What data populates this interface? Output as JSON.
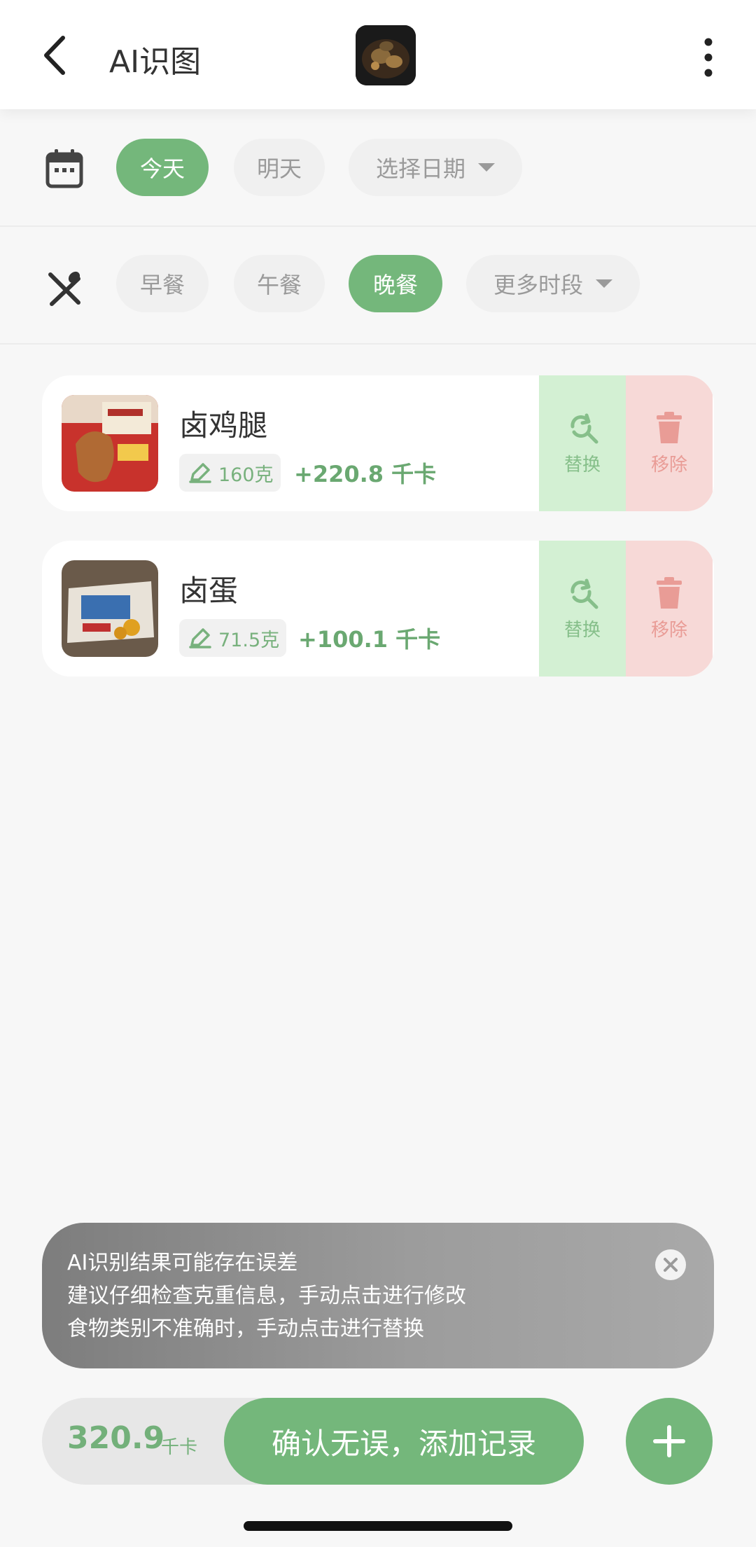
{
  "header": {
    "title": "AI识图",
    "back_icon": "chevron-left-icon",
    "more_icon": "more-vertical-icon"
  },
  "date_row": {
    "icon": "calendar-icon",
    "chips": [
      "今天",
      "明天",
      "选择日期"
    ],
    "active": "今天"
  },
  "meal_row": {
    "icon": "utensils-icon",
    "chips": [
      "早餐",
      "午餐",
      "晚餐",
      "更多时段"
    ],
    "active": "晚餐"
  },
  "foods": [
    {
      "name": "卤鸡腿",
      "weight": "160克",
      "kcal": "+220.8 千卡",
      "replace_label": "替换",
      "remove_label": "移除"
    },
    {
      "name": "卤蛋",
      "weight": "71.5克",
      "kcal": "+100.1 千卡",
      "replace_label": "替换",
      "remove_label": "移除"
    }
  ],
  "tip": {
    "lines": [
      "AI识别结果可能存在误差",
      "建议仔细检查克重信息，手动点击进行修改",
      "食物类别不准确时，手动点击进行替换"
    ]
  },
  "bottom": {
    "total": "320.9",
    "unit": "千卡",
    "confirm_label": "确认无误，添加记录"
  },
  "colors": {
    "accent": "#74b77b",
    "replace_bg": "#d3f0d3",
    "remove_bg": "#f7d9d7"
  }
}
